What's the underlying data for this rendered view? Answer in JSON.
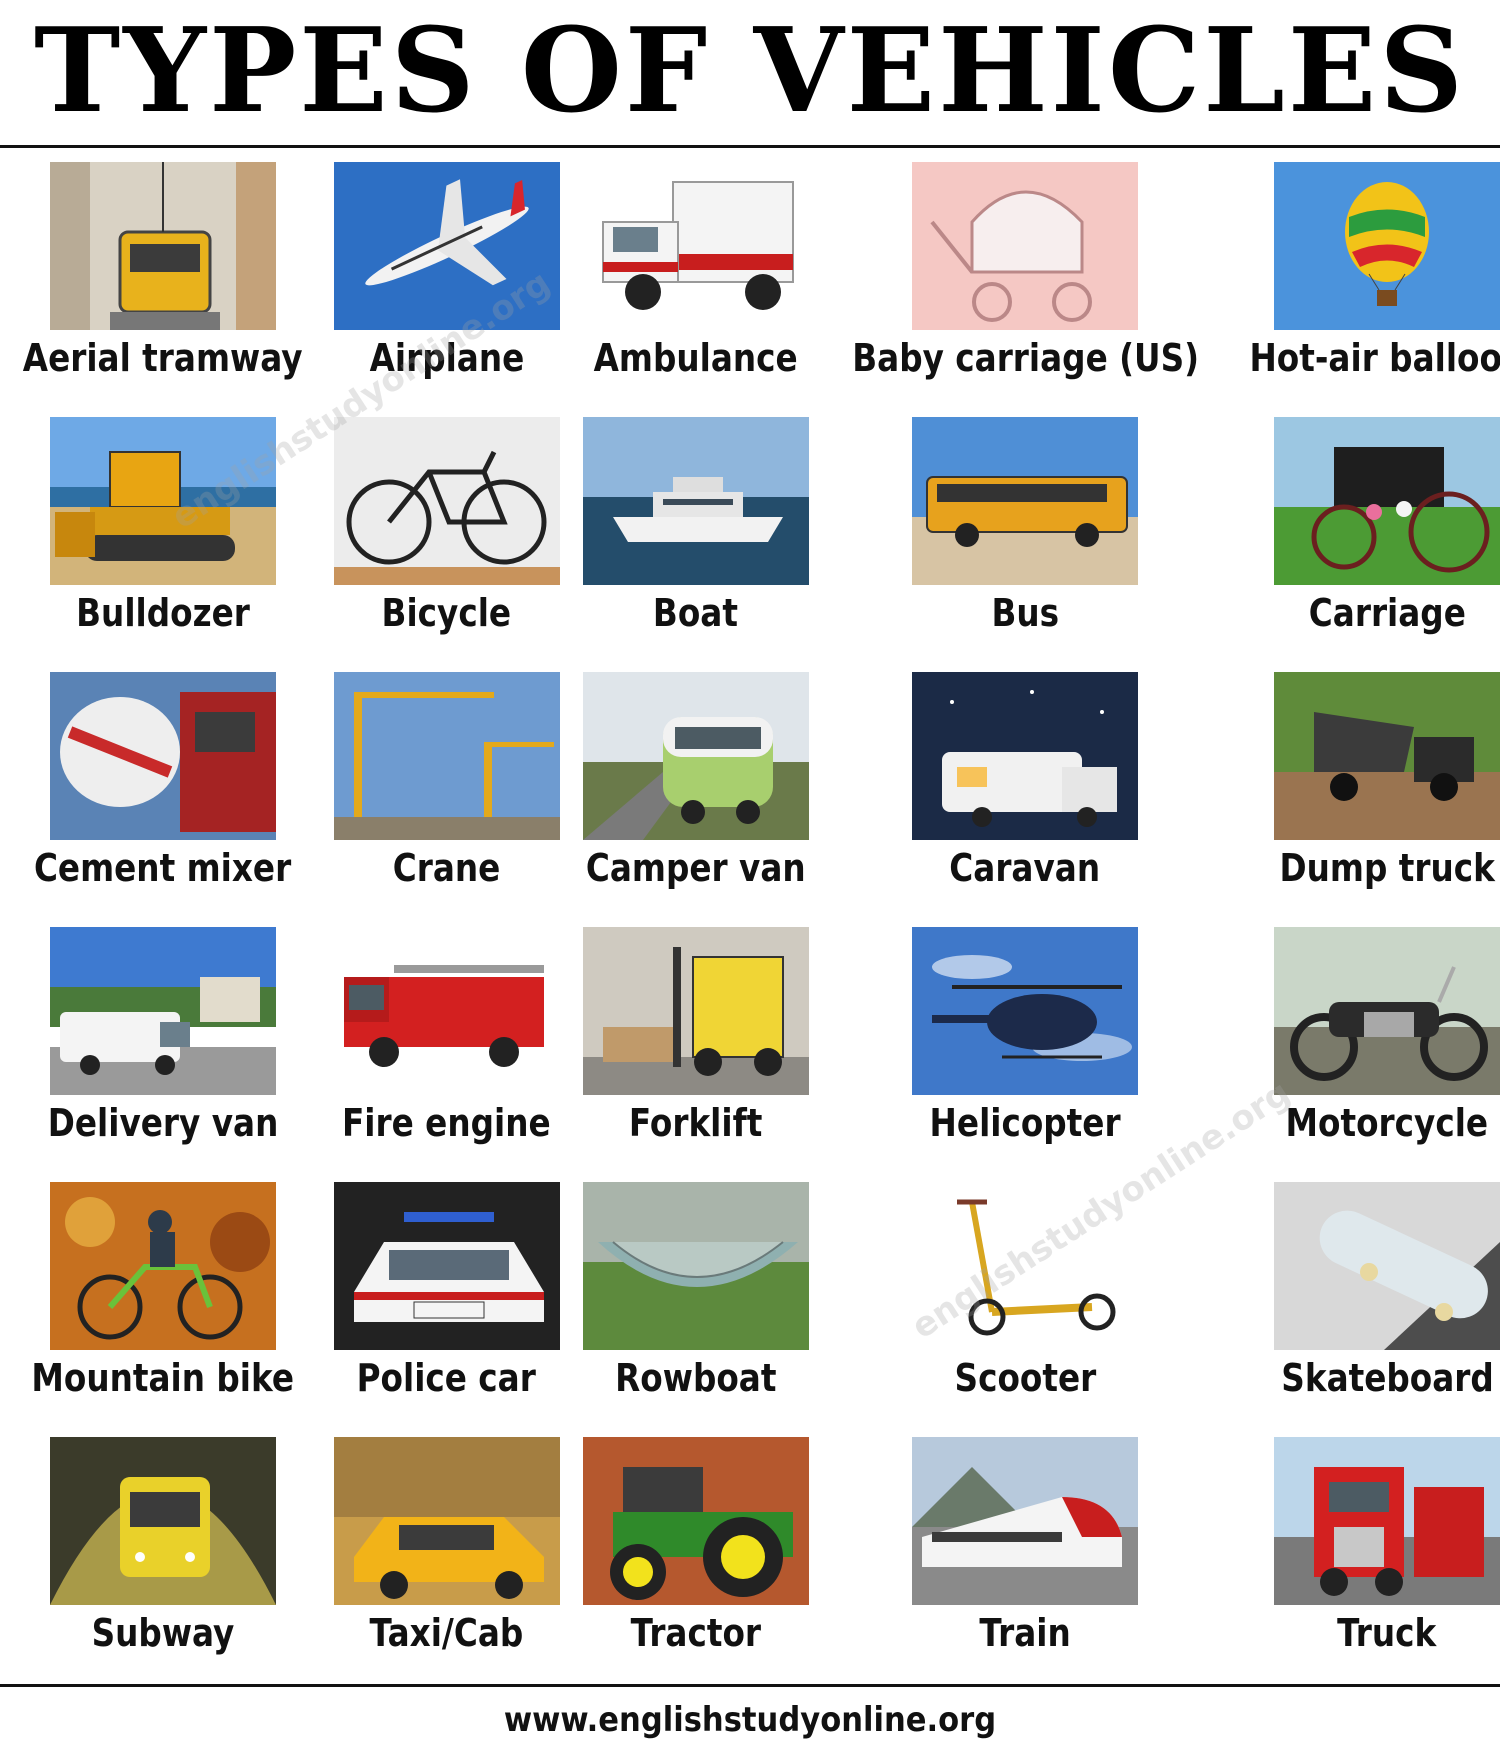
{
  "title": "TYPES OF VEHICLES",
  "footer": "www.englishstudyonline.org",
  "watermark": "englishstudyonline.org",
  "vehicles": [
    {
      "label": "Aerial tramway",
      "icon": "tram"
    },
    {
      "label": "Airplane",
      "icon": "plane"
    },
    {
      "label": "Ambulance",
      "icon": "ambulance"
    },
    {
      "label": "Baby carriage (US)",
      "icon": "pram"
    },
    {
      "label": "Hot-air balloon",
      "icon": "balloon"
    },
    {
      "label": "Bulldozer",
      "icon": "bulldozer"
    },
    {
      "label": "Bicycle",
      "icon": "bicycle"
    },
    {
      "label": "Boat",
      "icon": "boat"
    },
    {
      "label": "Bus",
      "icon": "bus"
    },
    {
      "label": "Carriage",
      "icon": "carriage"
    },
    {
      "label": "Cement mixer",
      "icon": "mixer"
    },
    {
      "label": "Crane",
      "icon": "crane"
    },
    {
      "label": "Camper van",
      "icon": "camper"
    },
    {
      "label": "Caravan",
      "icon": "caravan"
    },
    {
      "label": "Dump truck",
      "icon": "dump"
    },
    {
      "label": "Delivery van",
      "icon": "van"
    },
    {
      "label": "Fire engine",
      "icon": "fire"
    },
    {
      "label": "Forklift",
      "icon": "forklift"
    },
    {
      "label": "Helicopter",
      "icon": "heli"
    },
    {
      "label": "Motorcycle",
      "icon": "moto"
    },
    {
      "label": "Mountain bike",
      "icon": "mtb"
    },
    {
      "label": "Police car",
      "icon": "police"
    },
    {
      "label": "Rowboat",
      "icon": "rowboat"
    },
    {
      "label": "Scooter",
      "icon": "scooter"
    },
    {
      "label": "Skateboard",
      "icon": "skate"
    },
    {
      "label": "Subway",
      "icon": "subway"
    },
    {
      "label": "Taxi/Cab",
      "icon": "taxi"
    },
    {
      "label": "Tractor",
      "icon": "tractor"
    },
    {
      "label": "Train",
      "icon": "train"
    },
    {
      "label": "Truck",
      "icon": "truck"
    }
  ]
}
